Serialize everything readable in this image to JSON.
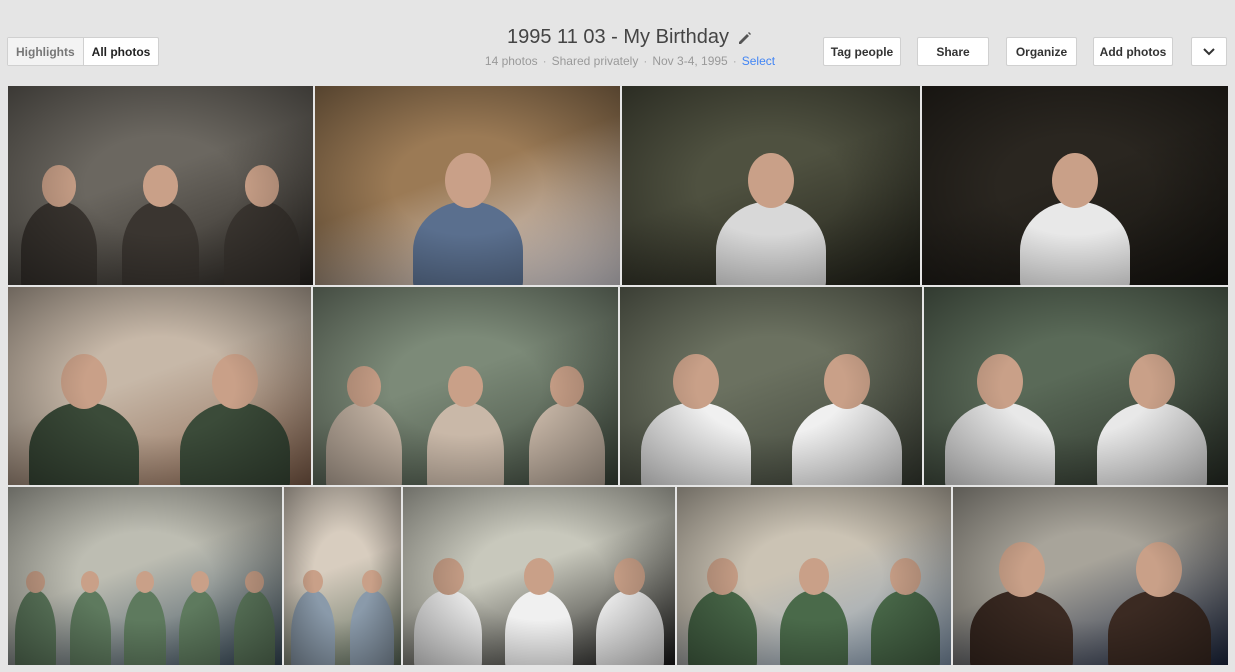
{
  "view_toggle": {
    "highlights_label": "Highlights",
    "all_photos_label": "All photos"
  },
  "album": {
    "title": "1995 11 03 - My Birthday",
    "photo_count": "14 photos",
    "sharing": "Shared privately",
    "date_range": "Nov 3-4, 1995",
    "select_label": "Select"
  },
  "toolbar": {
    "tag_people_label": "Tag people",
    "share_label": "Share",
    "organize_label": "Organize",
    "add_photos_label": "Add photos",
    "more_icon": "chevron-down-icon"
  },
  "photos": [
    {
      "id": 1,
      "colors": [
        "#6b6760",
        "#2a2622",
        "#3a3530"
      ]
    },
    {
      "id": 2,
      "colors": [
        "#9b7a55",
        "#e8e4ea",
        "#5a6f8e"
      ]
    },
    {
      "id": 3,
      "colors": [
        "#4f5140",
        "#202018",
        "#d8d8d8"
      ]
    },
    {
      "id": 4,
      "colors": [
        "#2a2620",
        "#161410",
        "#e8e8e8"
      ]
    },
    {
      "id": 5,
      "colors": [
        "#c7b8a8",
        "#8a6650",
        "#3b4b39"
      ]
    },
    {
      "id": 6,
      "colors": [
        "#7c8a78",
        "#3f4a3e",
        "#c9b8a8"
      ]
    },
    {
      "id": 7,
      "colors": [
        "#6b7160",
        "#3b4036",
        "#f0f0f0"
      ]
    },
    {
      "id": 8,
      "colors": [
        "#5a6a58",
        "#2a3028",
        "#e8e8e8"
      ]
    },
    {
      "id": 9,
      "colors": [
        "#bdbdb2",
        "#3b4f5f",
        "#5e7a5e"
      ]
    },
    {
      "id": 10,
      "colors": [
        "#d8cdbf",
        "#5f6f5f",
        "#8a9aaa"
      ]
    },
    {
      "id": 11,
      "colors": [
        "#c8c8bc",
        "#1a1a1a",
        "#f0f0f0"
      ]
    },
    {
      "id": 12,
      "colors": [
        "#cbc3b4",
        "#8aa0b8",
        "#4a6a4a"
      ]
    },
    {
      "id": 13,
      "colors": [
        "#a8a49a",
        "#1f2a44",
        "#3b2a22"
      ]
    }
  ]
}
